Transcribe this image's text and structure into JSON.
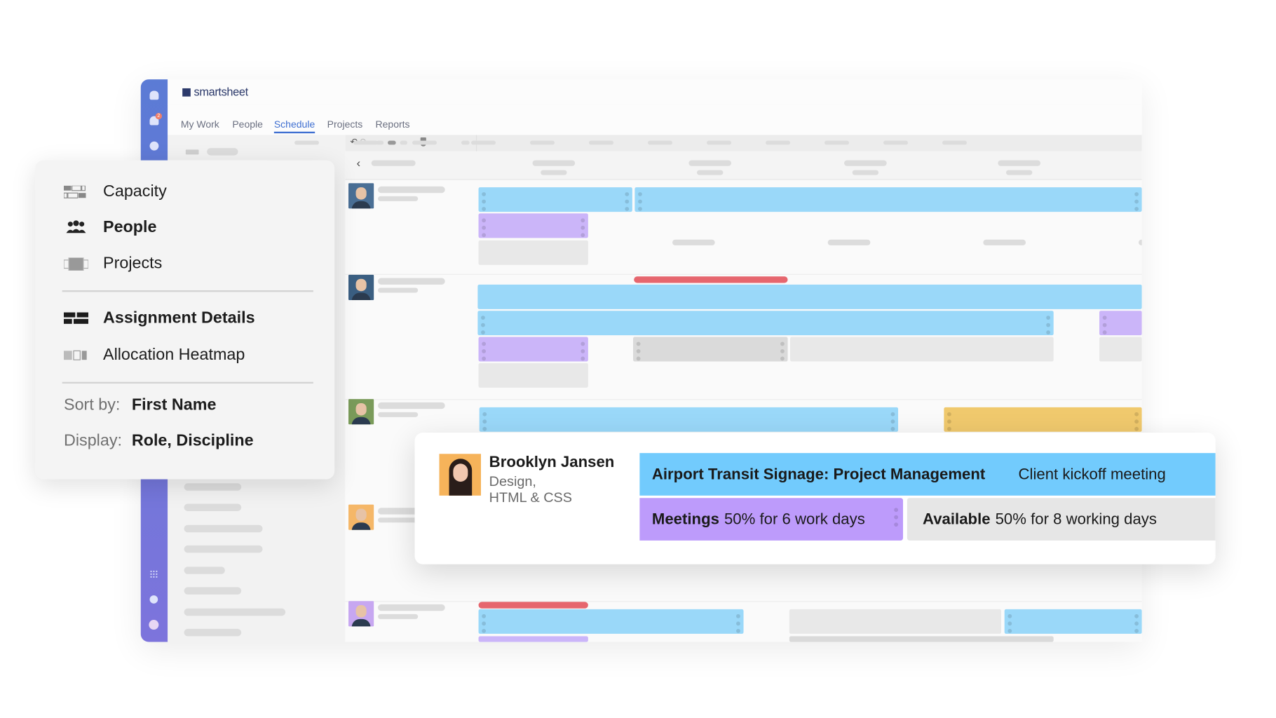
{
  "app": {
    "brand": "smartsheet",
    "notification_count": "2",
    "nav_tabs": [
      {
        "label": "My Work",
        "active": false
      },
      {
        "label": "People",
        "active": false
      },
      {
        "label": "Schedule",
        "active": true
      },
      {
        "label": "Projects",
        "active": false
      },
      {
        "label": "Reports",
        "active": false
      }
    ],
    "colors": {
      "accent": "#3f6fd1",
      "rail_top": "#5b7bd5",
      "rail_bottom": "#7d74dc",
      "bar_blue": "#9ad8f9",
      "bar_purple": "#cbb5f9",
      "bar_yellow": "#f0c96d",
      "bar_red": "#e6666e"
    }
  },
  "view_menu": {
    "views": [
      {
        "label": "Capacity",
        "icon": "capacity-icon",
        "selected": false
      },
      {
        "label": "People",
        "icon": "people-icon",
        "selected": true
      },
      {
        "label": "Projects",
        "icon": "projects-icon",
        "selected": false
      }
    ],
    "modes": [
      {
        "label": "Assignment Details",
        "icon": "assignment-details-icon",
        "selected": true
      },
      {
        "label": "Allocation Heatmap",
        "icon": "heatmap-icon",
        "selected": false
      }
    ],
    "sort_label": "Sort by:",
    "sort_value": "First Name",
    "display_label": "Display:",
    "display_value": "Role, Discipline"
  },
  "detail_card": {
    "name": "Brooklyn Jansen",
    "role_line1": "Design,",
    "role_line2": "HTML & CSS",
    "project": {
      "title": "Airport Transit Signage: Project Management",
      "phase": "Client kickoff meeting"
    },
    "meetings": {
      "label": "Meetings",
      "detail": "50% for 6 work days"
    },
    "available": {
      "label": "Available",
      "detail": "50% for 8 working days"
    }
  }
}
